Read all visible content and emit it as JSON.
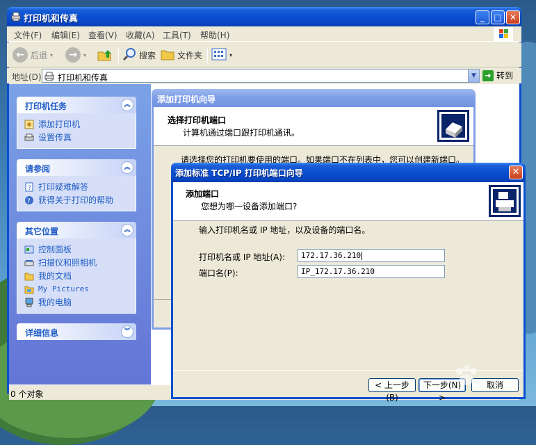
{
  "window": {
    "title": "打印机和传真"
  },
  "menu": [
    "文件(F)",
    "编辑(E)",
    "查看(V)",
    "收藏(A)",
    "工具(T)",
    "帮助(H)"
  ],
  "toolbar": {
    "back": "后退",
    "search": "搜索",
    "folders": "文件夹"
  },
  "address": {
    "label": "地址(D)",
    "value": "打印机和传真",
    "go": "转到"
  },
  "panels": {
    "printer_tasks": {
      "title": "打印机任务",
      "items": [
        "添加打印机",
        "设置传真"
      ]
    },
    "see_also": {
      "title": "请参阅",
      "items": [
        "打印疑难解答",
        "获得关于打印的帮助"
      ]
    },
    "other_places": {
      "title": "其它位置",
      "items": [
        "控制面板",
        "扫描仪和照相机",
        "我的文档",
        "My Pictures",
        "我的电脑"
      ]
    },
    "details": {
      "title": "详细信息"
    }
  },
  "status": {
    "text": "0 个对象"
  },
  "wizard": {
    "title": "添加打印机向导",
    "heading": "选择打印机端口",
    "subheading": "计算机通过端口跟打印机通讯。",
    "instruction": "请选择您的打印机要使用的端口。如果端口不在列表中，您可以创建新端口。"
  },
  "dialog": {
    "title": "添加标准 TCP/IP 打印机端口向导",
    "heading": "添加端口",
    "subheading": "您想为哪一设备添加端口?",
    "instruction": "输入打印机名或 IP 地址，以及设备的端口名。",
    "printer_label": "打印机名或 IP 地址(A):",
    "printer_value": "172.17.36.210",
    "port_label": "端口名(P):",
    "port_value": "IP_172.17.36.210",
    "back_button": "< 上一步(B)",
    "next_button": "下一步(N) >",
    "cancel_button": "取消"
  }
}
